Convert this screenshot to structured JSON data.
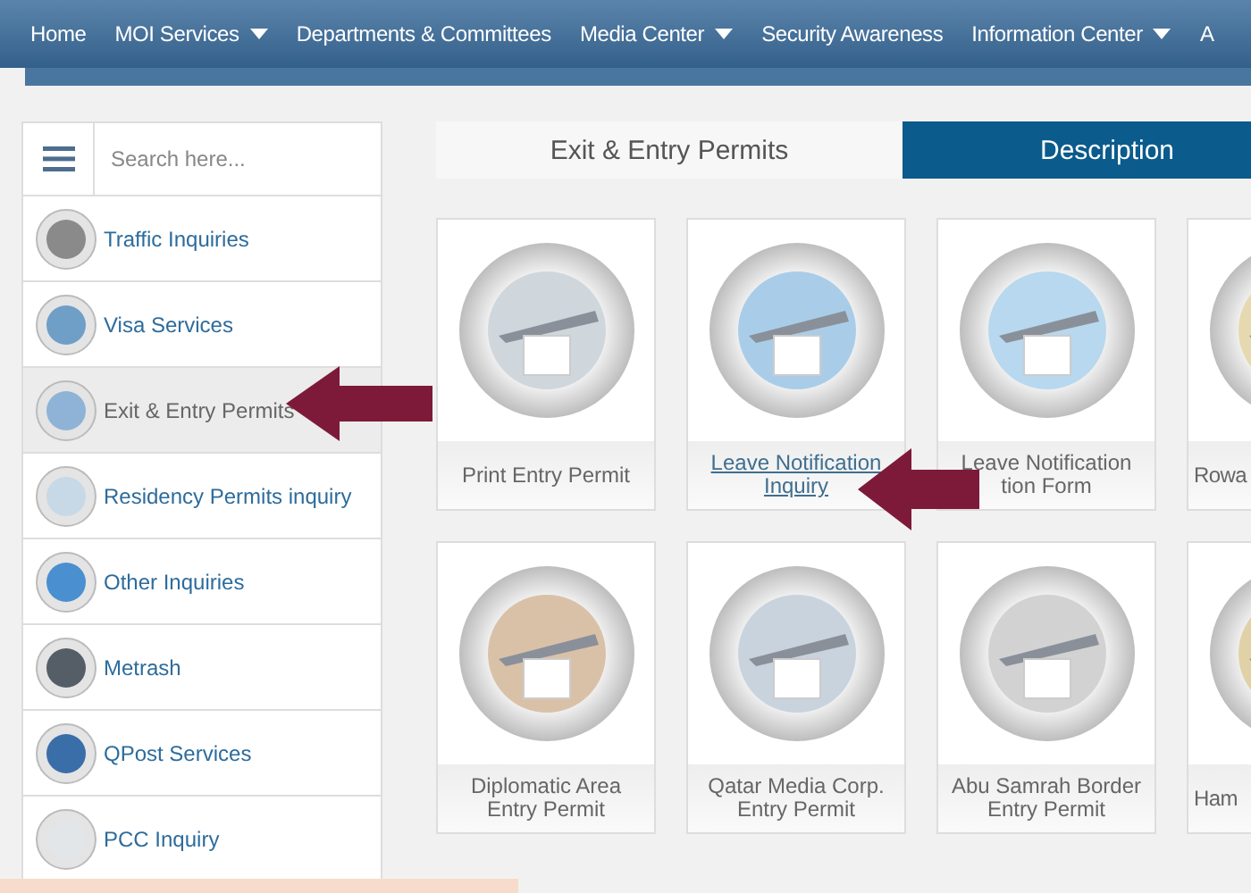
{
  "nav": [
    {
      "label": "Home",
      "has_menu": false
    },
    {
      "label": "MOI Services",
      "has_menu": true
    },
    {
      "label": "Departments & Committees",
      "has_menu": false
    },
    {
      "label": "Media Center",
      "has_menu": true
    },
    {
      "label": "Security Awareness",
      "has_menu": false
    },
    {
      "label": "Information Center",
      "has_menu": true
    },
    {
      "label": "A",
      "has_menu": false
    }
  ],
  "search": {
    "placeholder": "Search here..."
  },
  "sidebar": {
    "items": [
      {
        "label": "Traffic Inquiries",
        "selected": false
      },
      {
        "label": "Visa Services",
        "selected": false
      },
      {
        "label": "Exit & Entry Permits",
        "selected": true
      },
      {
        "label": "Residency Permits inquiry",
        "selected": false
      },
      {
        "label": "Other Inquiries",
        "selected": false
      },
      {
        "label": "Metrash",
        "selected": false
      },
      {
        "label": "QPost Services",
        "selected": false
      },
      {
        "label": "PCC Inquiry",
        "selected": false
      }
    ]
  },
  "header": {
    "title": "Exit & Entry Permits",
    "tab": "Description"
  },
  "cards": [
    {
      "lines": [
        "Print Entry Permit"
      ],
      "hovered": false
    },
    {
      "lines": [
        "Leave Notification",
        "Inquiry"
      ],
      "hovered": true
    },
    {
      "lines": [
        "Leave Notification",
        "tion Form"
      ],
      "hovered": false
    },
    {
      "lines": [
        "Rowa"
      ],
      "hovered": false
    },
    {
      "lines": [
        "Diplomatic Area",
        "Entry Permit"
      ],
      "hovered": false
    },
    {
      "lines": [
        "Qatar Media Corp.",
        "Entry Permit"
      ],
      "hovered": false
    },
    {
      "lines": [
        "Abu Samrah Border",
        "Entry Permit"
      ],
      "hovered": false
    },
    {
      "lines": [
        "Ham"
      ],
      "hovered": false
    }
  ]
}
